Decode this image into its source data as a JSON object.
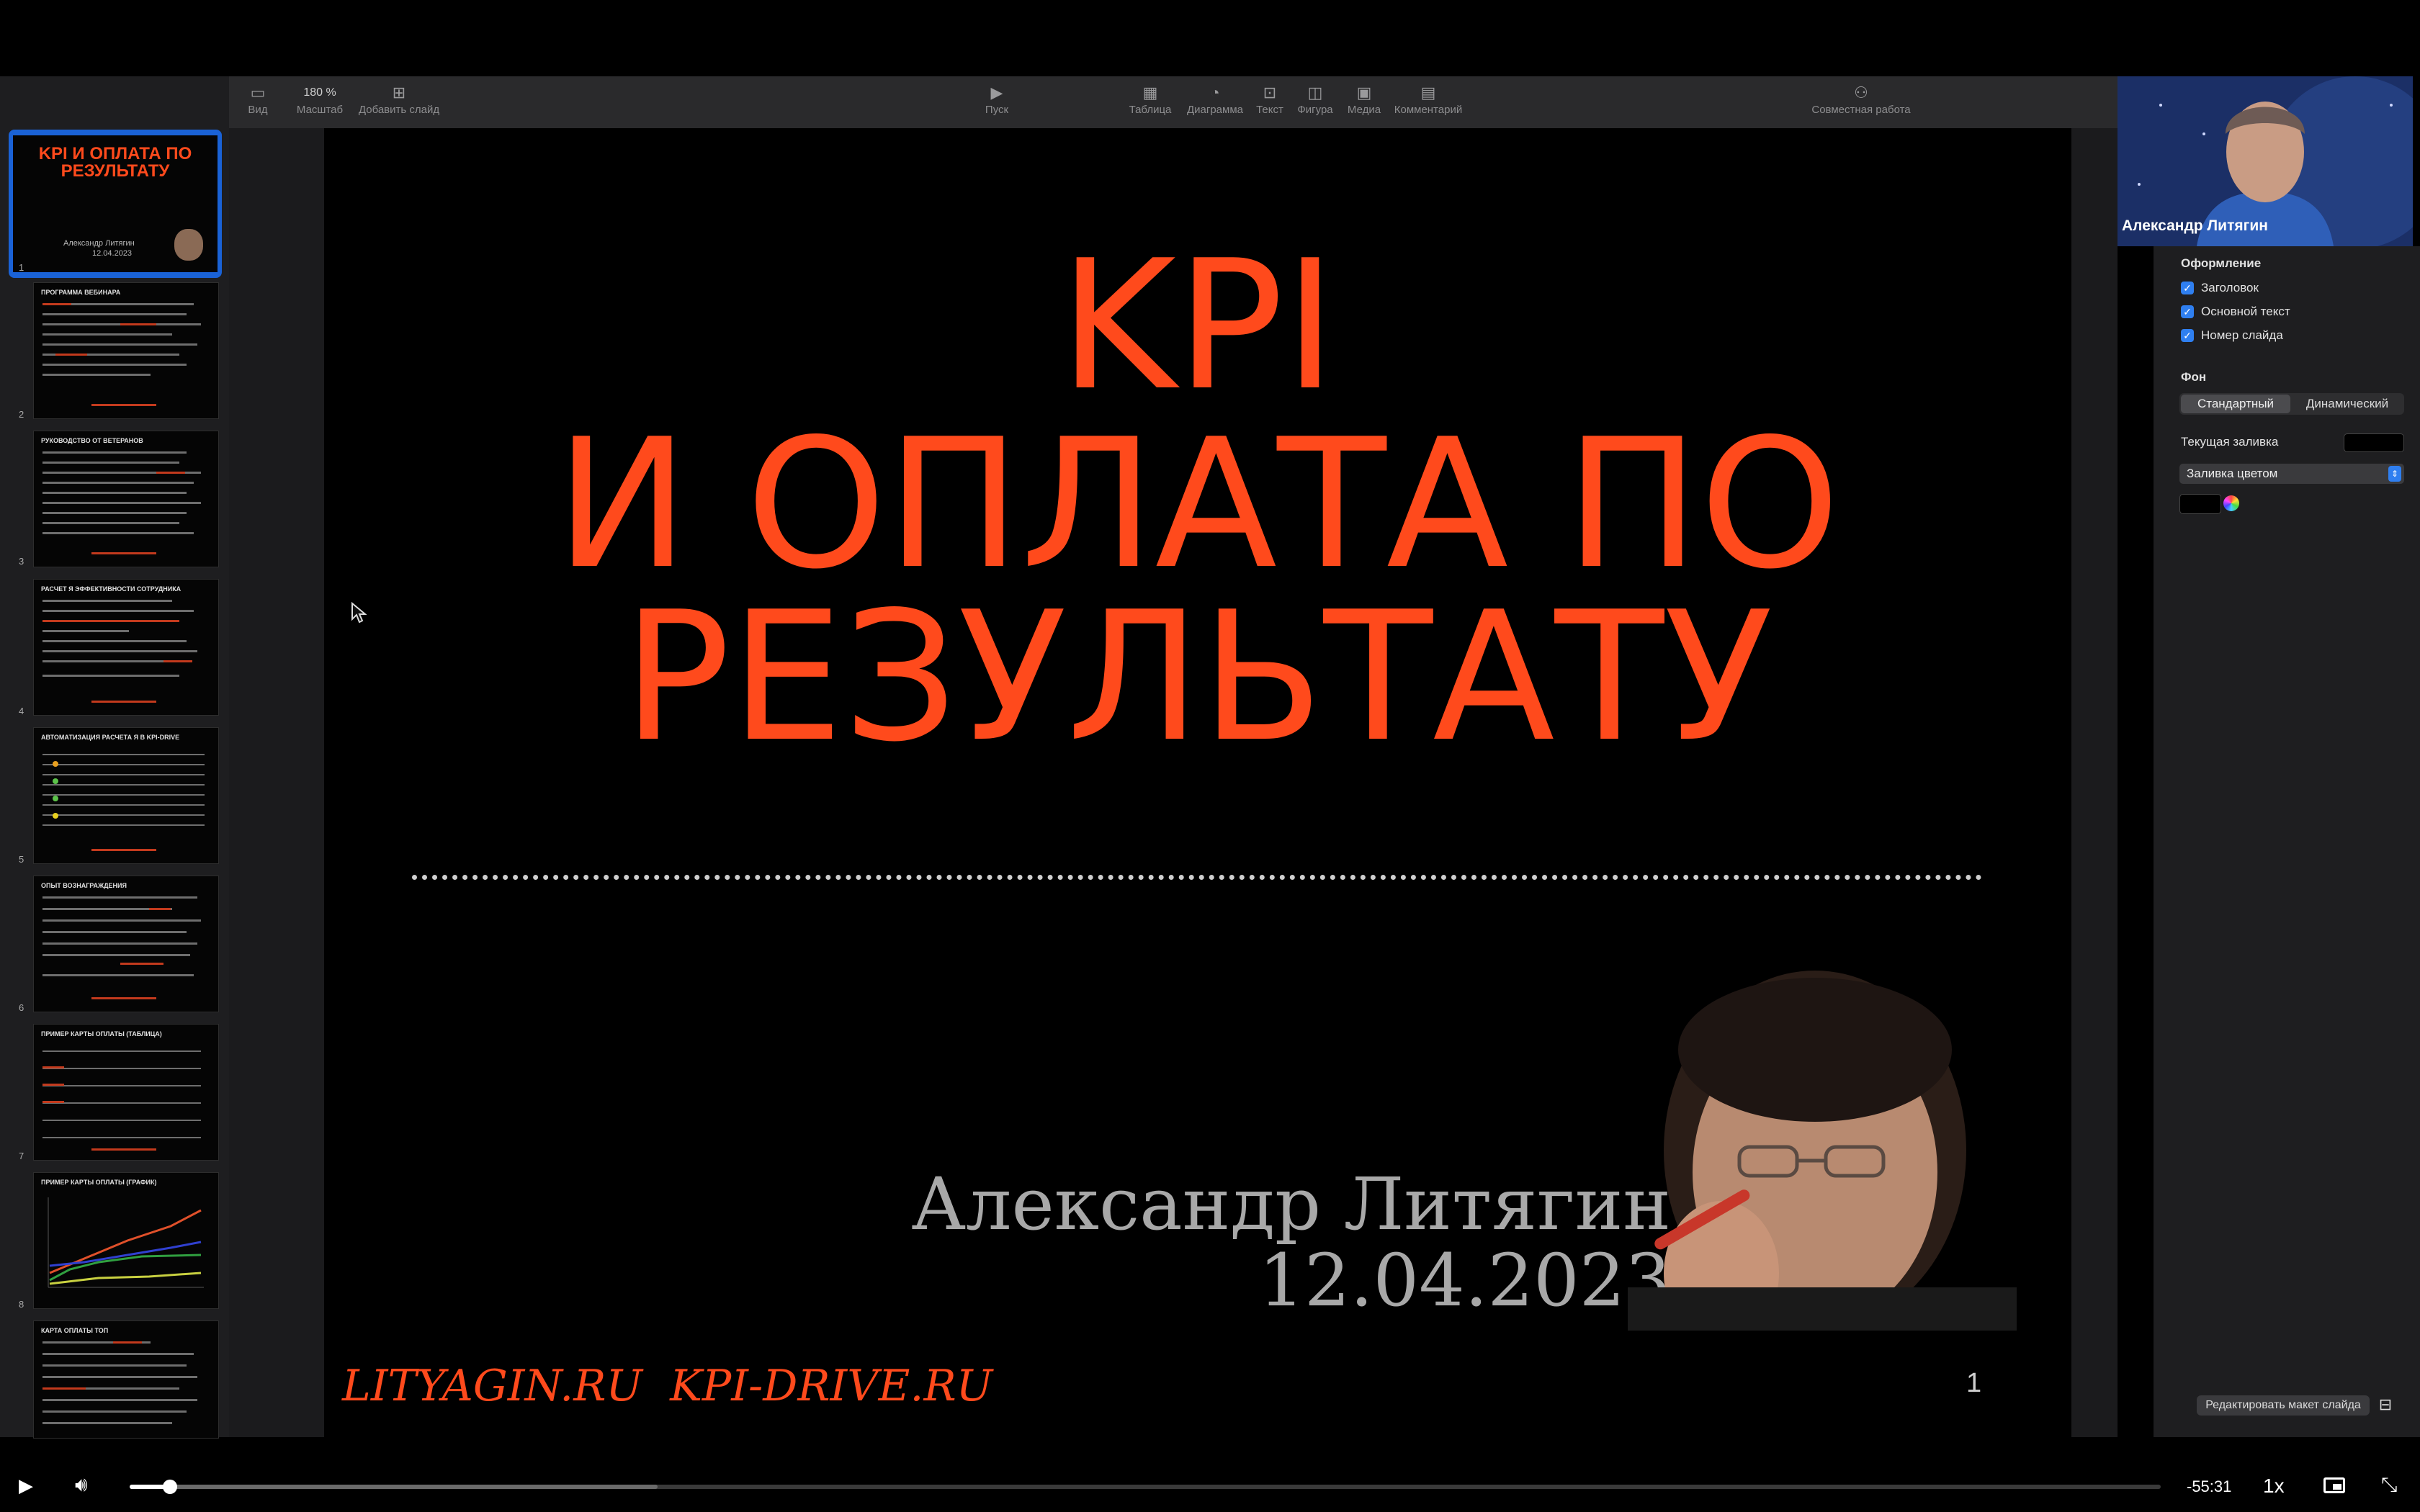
{
  "toolbar": {
    "zoom_value": "180 %",
    "view": "Вид",
    "zoom": "Масштаб",
    "add_slide": "Добавить слайд",
    "play": "Пуск",
    "table": "Таблица",
    "chart": "Диаграмма",
    "text": "Текст",
    "shape": "Фигура",
    "media": "Медиа",
    "comment": "Комментарий",
    "collaborate": "Совместная работа"
  },
  "slide": {
    "title_line1": "KPI",
    "title_line2": "И ОПЛАТА ПО",
    "title_line3": "РЕЗУЛЬТАТУ",
    "author": "Александр Литягин",
    "date": "12.04.2023",
    "websites": "LITYAGIN.RU  KPI-DRIVE.RU",
    "slide_number": "1"
  },
  "thumbnails": [
    {
      "num": "1",
      "title": "KPI И ОПЛАТА ПО РЕЗУЛЬТАТУ",
      "author": "Александр Литягин",
      "date": "12.04.2023"
    },
    {
      "num": "2",
      "title": "ПРОГРАММА ВЕБИНАРА"
    },
    {
      "num": "3",
      "title": "РУКОВОДСТВО ОТ ВЕТЕРАНОВ"
    },
    {
      "num": "4",
      "title": "РАСЧЕТ Я ЭФФЕКТИВНОСТИ СОТРУДНИКА"
    },
    {
      "num": "5",
      "title": "АВТОМАТИЗАЦИЯ РАСЧЕТА Я В KPI-DRIVE"
    },
    {
      "num": "6",
      "title": "ОПЫТ ВОЗНАГРАЖДЕНИЯ"
    },
    {
      "num": "7",
      "title": "ПРИМЕР КАРТЫ ОПЛАТЫ (ТАБЛИЦА)"
    },
    {
      "num": "8",
      "title": "ПРИМЕР КАРТЫ ОПЛАТЫ (ГРАФИК)"
    },
    {
      "num": "",
      "title": "КАРТА ОПЛАТЫ ТОП"
    }
  ],
  "video": {
    "name": "Александр Литягин"
  },
  "inspector": {
    "section_design": "Оформление",
    "title_cb": "Заголовок",
    "body_cb": "Основной текст",
    "number_cb": "Номер слайда",
    "section_bg": "Фон",
    "seg_standard": "Стандартный",
    "seg_dynamic": "Динамический",
    "current_fill": "Текущая заливка",
    "fill_type": "Заливка цветом",
    "edit_layout": "Редактировать макет слайда"
  },
  "player": {
    "time_remaining": "-55:31",
    "speed": "1x",
    "progress": 0.02,
    "buffered": 0.26
  },
  "colors": {
    "accent_red": "#ff4a1c",
    "selection_blue": "#2f7ff0"
  }
}
